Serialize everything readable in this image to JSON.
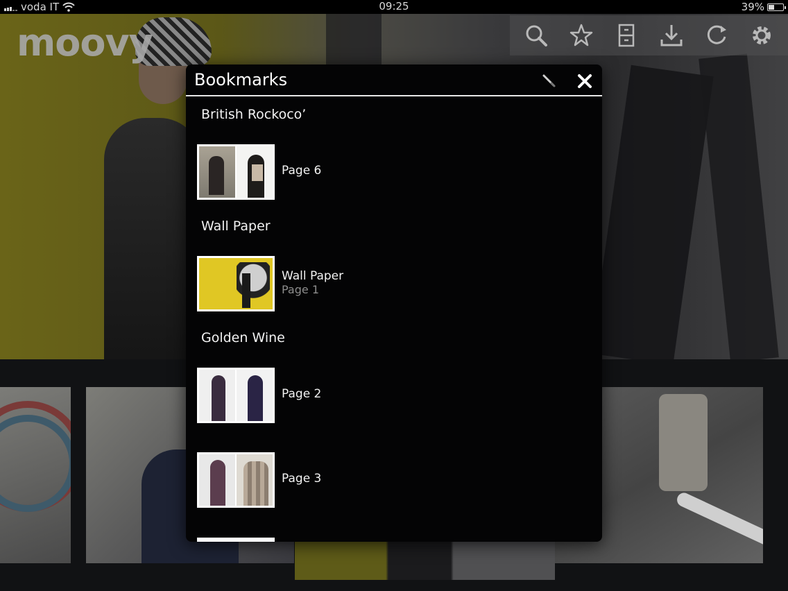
{
  "status_bar": {
    "carrier": "voda IT",
    "time": "09:25",
    "battery_percent": "39%",
    "battery_level": 0.39
  },
  "app": {
    "logo": "moovy"
  },
  "toolbar": {
    "buttons": [
      {
        "icon": "search-icon"
      },
      {
        "icon": "star-icon"
      },
      {
        "icon": "archive-icon"
      },
      {
        "icon": "download-icon"
      },
      {
        "icon": "refresh-icon"
      },
      {
        "icon": "gear-icon"
      }
    ]
  },
  "bookmarks": {
    "title": "Bookmarks",
    "sections": [
      {
        "title": "British Rockoco’",
        "items": [
          {
            "label": "Page 6",
            "sub": ""
          }
        ]
      },
      {
        "title": "Wall Paper",
        "items": [
          {
            "label": "Wall Paper",
            "sub": "Page 1"
          }
        ]
      },
      {
        "title": "Golden Wine",
        "items": [
          {
            "label": "Page 2",
            "sub": ""
          },
          {
            "label": "Page 3",
            "sub": ""
          }
        ]
      }
    ]
  },
  "colors": {
    "panel_bg": "#040405",
    "header_rule": "#e8e8e8",
    "subtitle_text": "#8d8d8d"
  }
}
